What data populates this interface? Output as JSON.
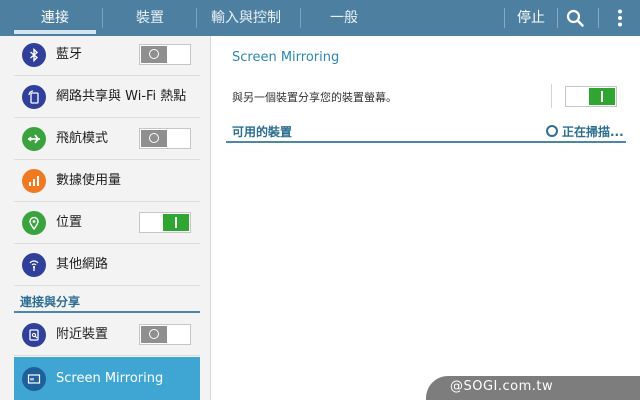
{
  "tabs": [
    {
      "label": "連接",
      "active": true
    },
    {
      "label": "裝置",
      "active": false
    },
    {
      "label": "輸入與控制",
      "active": false
    },
    {
      "label": "一般",
      "active": false
    }
  ],
  "toolbar": {
    "stop_label": "停止",
    "search_icon": "search-icon",
    "more_icon": "more-vert-icon"
  },
  "sidebar": {
    "items": [
      {
        "label": "藍牙",
        "icon": "bluetooth-icon",
        "icon_color": "#2f3f9a",
        "switch": "off"
      },
      {
        "label": "網路共享與 Wi-Fi 熱點",
        "icon": "tethering-icon",
        "icon_color": "#2f3f9a",
        "switch": null
      },
      {
        "label": "飛航模式",
        "icon": "airplane-icon",
        "icon_color": "#3aa340",
        "switch": "off"
      },
      {
        "label": "數據使用量",
        "icon": "data-usage-icon",
        "icon_color": "#ef7a22",
        "switch": null
      },
      {
        "label": "位置",
        "icon": "location-icon",
        "icon_color": "#3aa340",
        "switch": "on"
      },
      {
        "label": "其他網路",
        "icon": "more-networks-icon",
        "icon_color": "#2f3f9a",
        "switch": null
      }
    ],
    "section_title": "連接與分享",
    "section_items": [
      {
        "label": "附近裝置",
        "icon": "nearby-devices-icon",
        "icon_color": "#2f3f9a",
        "switch": "off"
      },
      {
        "label": "Screen Mirroring",
        "icon": "screen-mirroring-icon",
        "icon_color": "#1f5f9b",
        "selected": true
      }
    ]
  },
  "main": {
    "title": "Screen Mirroring",
    "description": "與另一個裝置分享您的裝置螢幕。",
    "switch": "on",
    "devices_title": "可用的裝置",
    "scan_status": "正在掃描..."
  },
  "watermark": {
    "text": "@SOGI.com.tw"
  },
  "colors": {
    "top_bar": "#4d7fa0",
    "accent": "#2c87b0",
    "selected_item": "#3fa6d3",
    "switch_on": "#2fa632",
    "switch_off": "#8f8f8f"
  }
}
